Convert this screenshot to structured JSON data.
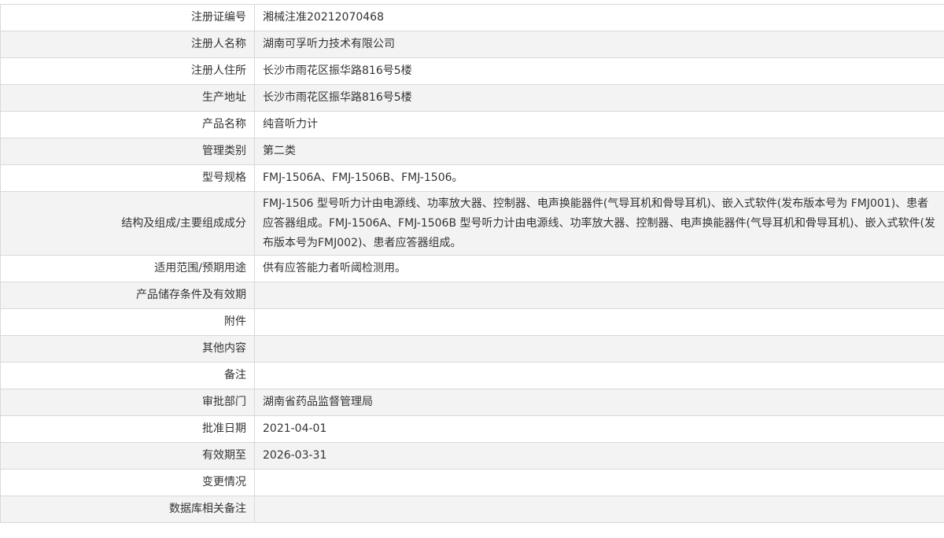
{
  "rows": [
    {
      "label": "注册证编号",
      "value": "湘械注准20212070468"
    },
    {
      "label": "注册人名称",
      "value": "湖南可孚听力技术有限公司"
    },
    {
      "label": "注册人住所",
      "value": "长沙市雨花区振华路816号5楼"
    },
    {
      "label": "生产地址",
      "value": "长沙市雨花区振华路816号5楼"
    },
    {
      "label": "产品名称",
      "value": "纯音听力计"
    },
    {
      "label": "管理类别",
      "value": "第二类"
    },
    {
      "label": "型号规格",
      "value": "FMJ-1506A、FMJ-1506B、FMJ-1506。"
    },
    {
      "label": "结构及组成/主要组成成分",
      "value": "FMJ-1506 型号听力计由电源线、功率放大器、控制器、电声换能器件(气导耳机和骨导耳机)、嵌入式软件(发布版本号为 FMJ001)、患者应答器组成。FMJ-1506A、FMJ-1506B 型号听力计由电源线、功率放大器、控制器、电声换能器件(气导耳机和骨导耳机)、嵌入式软件(发布版本号为FMJ002)、患者应答器组成。"
    },
    {
      "label": "适用范围/预期用途",
      "value": "供有应答能力者听阈检测用。"
    },
    {
      "label": "产品储存条件及有效期",
      "value": ""
    },
    {
      "label": "附件",
      "value": ""
    },
    {
      "label": "其他内容",
      "value": ""
    },
    {
      "label": "备注",
      "value": ""
    },
    {
      "label": "审批部门",
      "value": "湖南省药品监督管理局"
    },
    {
      "label": "批准日期",
      "value": "2021-04-01"
    },
    {
      "label": "有效期至",
      "value": "2026-03-31"
    },
    {
      "label": "变更情况",
      "value": ""
    },
    {
      "label": "数据库相关备注",
      "value": ""
    }
  ]
}
